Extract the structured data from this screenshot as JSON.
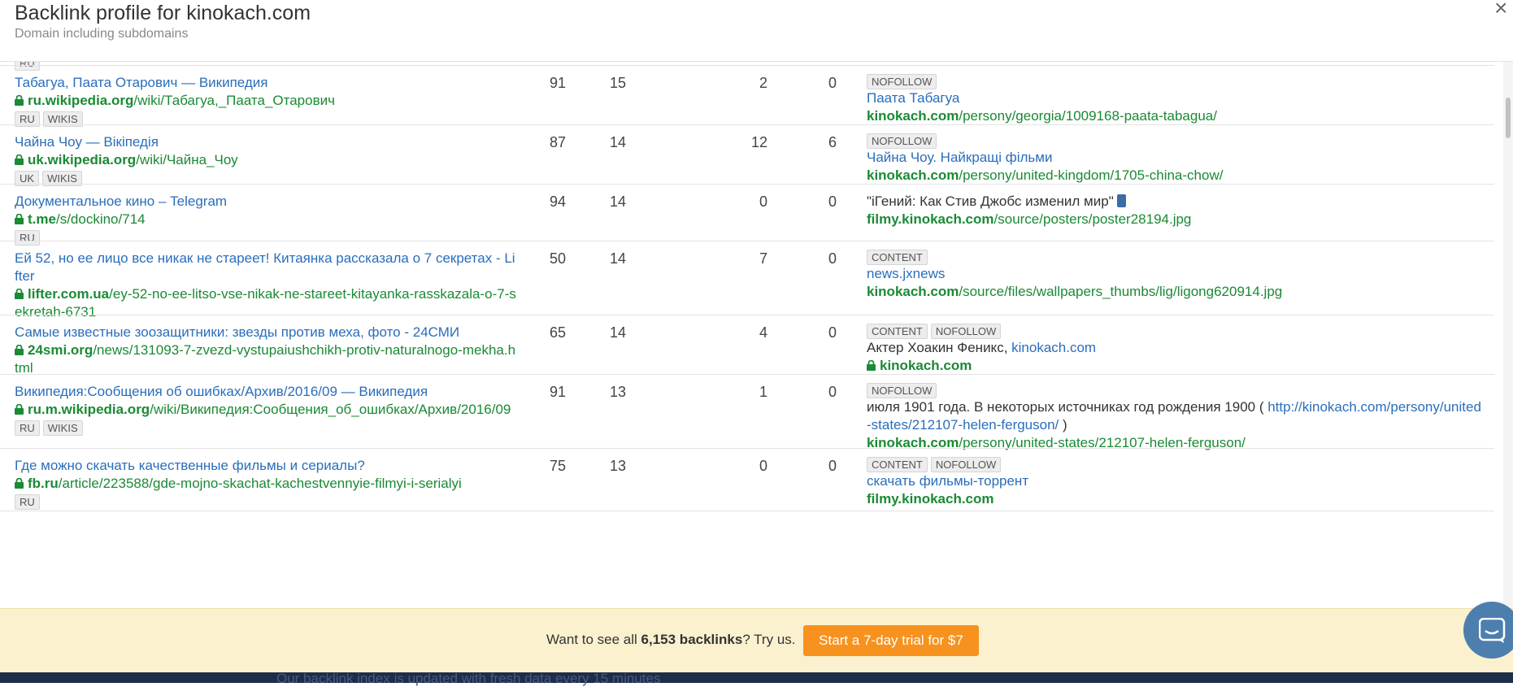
{
  "header": {
    "title": "Backlink profile for kinokach.com",
    "subtitle": "Domain including subdomains",
    "close_label": "×"
  },
  "prev_tag": "RU",
  "rows": [
    {
      "title": "Табагуа, Паата Отарович — Википедия",
      "domain": "ru.wikipedia.org",
      "path": "/wiki/Табагуа,_Паата_Отарович",
      "tags": [
        "RU",
        "WIKIS"
      ],
      "dr": "91",
      "ur": "15",
      "ext": "2",
      "int": "0",
      "link_tags": [
        "NOFOLLOW"
      ],
      "anchor_link": "Паата Табагуа",
      "target_domain": "kinokach.com",
      "target_path": "/persony/georgia/1009168-paata-tabagua/"
    },
    {
      "title": "Чайна Чоу — Вікіпедія",
      "domain": "uk.wikipedia.org",
      "path": "/wiki/Чайна_Чоу",
      "tags": [
        "UK",
        "WIKIS"
      ],
      "dr": "87",
      "ur": "14",
      "ext": "12",
      "int": "6",
      "link_tags": [
        "NOFOLLOW"
      ],
      "anchor_link": "Чайна Чоу. Найкращі фільми",
      "target_domain": "kinokach.com",
      "target_path": "/persony/united-kingdom/1705-china-chow/"
    },
    {
      "title": "Документальное кино – Telegram",
      "domain": "t.me",
      "path": "/s/dockino/714",
      "tags": [
        "RU"
      ],
      "dr": "94",
      "ur": "14",
      "ext": "0",
      "int": "0",
      "anchor_plain": "\"iГений: Как Стив Джобс изменил мир\"",
      "target_domain": "filmy.kinokach.com",
      "target_path": "/source/posters/poster28194.jpg"
    },
    {
      "title": "Ей 52, но ее лицо все никак не стареет! Китаянка рассказала о 7 секретах - Lifter",
      "domain": "lifter.com.ua",
      "path": "/ey-52-no-ee-litso-vse-nikak-ne-stareet-kitayanka-rasskazala-o-7-sekretah-6731",
      "tags": [],
      "dr": "50",
      "ur": "14",
      "ext": "7",
      "int": "0",
      "link_tags": [
        "CONTENT"
      ],
      "anchor_link": "news.jxnews",
      "target_domain": "kinokach.com",
      "target_path": "/source/files/wallpapers_thumbs/lig/ligong620914.jpg"
    },
    {
      "title": "Самые известные зоозащитники: звезды против меха, фото - 24СМИ",
      "domain": "24smi.org",
      "path": "/news/131093-7-zvezd-vystupaiushchikh-protiv-naturalnogo-mekha.html",
      "tags": [],
      "dr": "65",
      "ur": "14",
      "ext": "4",
      "int": "0",
      "link_tags": [
        "CONTENT",
        "NOFOLLOW"
      ],
      "anchor_plain": "Актер Хоакин Феникс, ",
      "anchor_inline_link": "kinokach.com",
      "target_domain": "kinokach.com",
      "target_path": ""
    },
    {
      "title": "Википедия:Сообщения об ошибках/Архив/2016/09 — Википедия",
      "domain": "ru.m.wikipedia.org",
      "path": "/wiki/Википедия:Сообщения_об_ошибках/Архив/2016/09",
      "tags": [
        "RU",
        "WIKIS"
      ],
      "dr": "91",
      "ur": "13",
      "ext": "1",
      "int": "0",
      "link_tags": [
        "NOFOLLOW"
      ],
      "anchor_plain": "июля 1901 года. В некоторых источниках год рождения 1900 ( ",
      "anchor_inline_link": "http://kinokach.com/persony/united-states/212107-helen-ferguson/",
      "anchor_tail": " )",
      "target_domain": "kinokach.com",
      "target_path": "/persony/united-states/212107-helen-ferguson/"
    },
    {
      "title": "Где можно скачать качественные фильмы и сериалы?",
      "domain": "fb.ru",
      "path": "/article/223588/gde-mojno-skachat-kachestvennyie-filmyi-i-serialyi",
      "tags": [
        "RU"
      ],
      "dr": "75",
      "ur": "13",
      "ext": "0",
      "int": "0",
      "link_tags": [
        "CONTENT",
        "NOFOLLOW"
      ],
      "anchor_link": "скачать фильмы-торрент",
      "target_domain": "filmy.kinokach.com",
      "target_path": ""
    }
  ],
  "banner": {
    "text_prefix": "Want to see all ",
    "count": "6,153 backlinks",
    "text_suffix": "? Try us.",
    "button_label": "Start a 7-day trial for $7"
  },
  "footer_text": "Our backlink index is updated with fresh data every 15 minutes",
  "colors": {
    "link_blue": "#2a6ebb",
    "url_green": "#1a8a34",
    "cta_orange": "#f7921e",
    "banner_bg": "#fbf1cf"
  }
}
